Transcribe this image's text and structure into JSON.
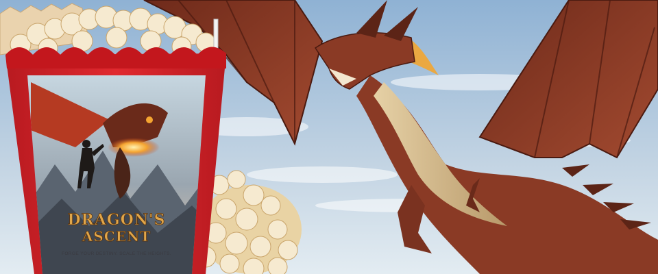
{
  "scene": {
    "description_labels": {
      "background": "sky-background",
      "dragon": "flying-red-dragon",
      "popcorn_box": "popcorn-box"
    },
    "colors": {
      "sky_top": "#8fb2d4",
      "sky_bottom": "#e3ecf2",
      "box_red": "#d8242b",
      "dragon_body": "#8a3a25",
      "dragon_belly": "#d9c29a",
      "dragon_fire": "#f2a531",
      "popcorn": "#f3e3bd"
    }
  },
  "poster": {
    "title_line1": "DRAGON'S",
    "title_line2": "ASCENT",
    "tagline": "FORGE YOUR DESTINY. SCALE THE HEIGHTS."
  }
}
